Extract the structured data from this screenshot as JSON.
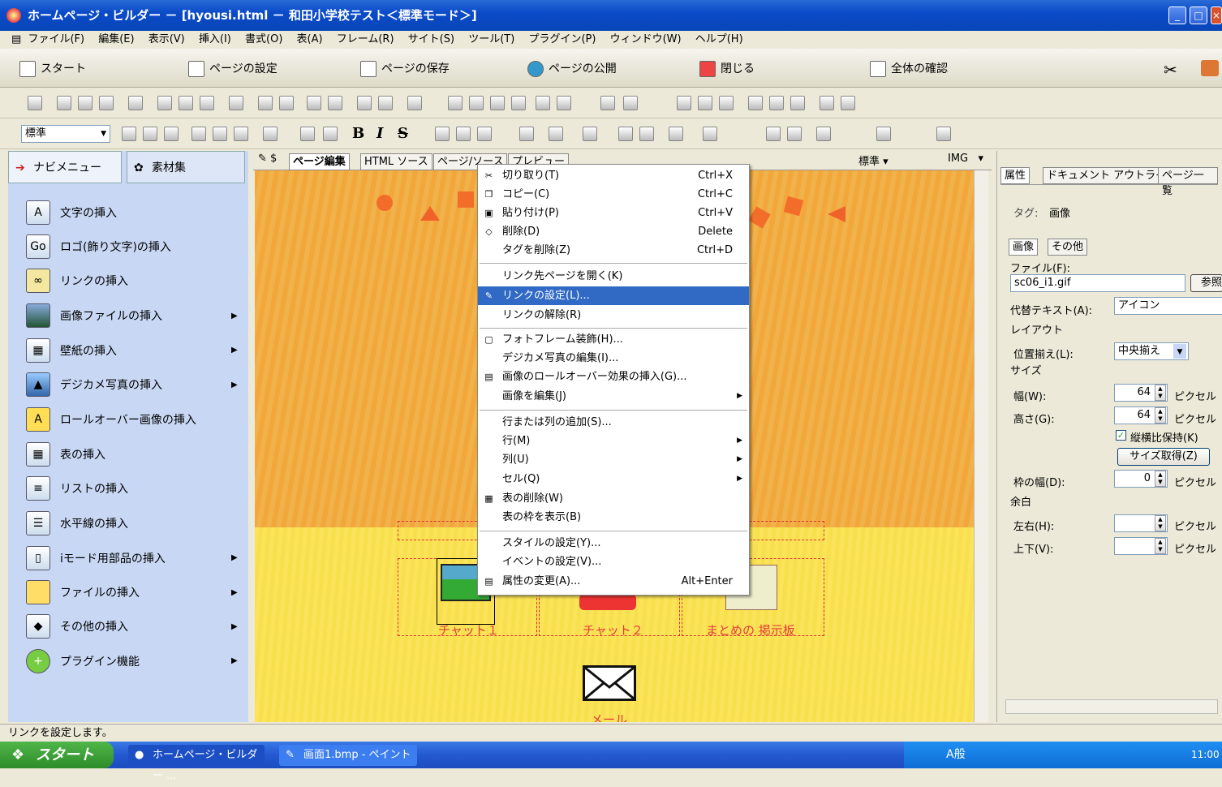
{
  "window": {
    "title": "ホームページ・ビルダー － [hyousi.html － 和田小学校テスト＜標準モード＞]"
  },
  "menubar": [
    "ファイル(F)",
    "編集(E)",
    "表示(V)",
    "挿入(I)",
    "書式(O)",
    "表(A)",
    "フレーム(R)",
    "サイト(S)",
    "ツール(T)",
    "プラグイン(P)",
    "ウィンドウ(W)",
    "ヘルプ(H)"
  ],
  "nav_toolbar": [
    "スタート",
    "ページの設定",
    "ページの保存",
    "ページの公開",
    "閉じる",
    "全体の確認"
  ],
  "format_toolbar": {
    "style_select": "標準",
    "bold": "B",
    "italic": "I",
    "strike": "S"
  },
  "left_panel": {
    "tabs": [
      "ナビメニュー",
      "素材集"
    ],
    "items": [
      "文字の挿入",
      "ロゴ(飾り文字)の挿入",
      "リンクの挿入",
      "画像ファイルの挿入",
      "壁紙の挿入",
      "デジカメ写真の挿入",
      "ロールオーバー画像の挿入",
      "表の挿入",
      "リストの挿入",
      "水平線の挿入",
      "iモード用部品の挿入",
      "ファイルの挿入",
      "その他の挿入",
      "プラグイン機能"
    ]
  },
  "editor": {
    "tabs": [
      "ページ編集",
      "HTML ソース",
      "ページ/ソース",
      "プレビュー"
    ],
    "style_dropdown": "標準",
    "element_dropdown": "IMG",
    "captions": [
      "チャット１",
      "チャット２",
      "まとめの 掲示板"
    ],
    "mail_caption": "メール"
  },
  "context_menu": {
    "items": [
      {
        "label": "切り取り(T)",
        "shortcut": "Ctrl+X"
      },
      {
        "label": "コピー(C)",
        "shortcut": "Ctrl+C"
      },
      {
        "label": "貼り付け(P)",
        "shortcut": "Ctrl+V"
      },
      {
        "label": "削除(D)",
        "shortcut": "Delete"
      },
      {
        "label": "タグを削除(Z)",
        "shortcut": "Ctrl+D"
      },
      {
        "label": "リンク先ページを開く(K)",
        "shortcut": ""
      },
      {
        "label": "リンクの設定(L)...",
        "shortcut": ""
      },
      {
        "label": "リンクの解除(R)",
        "shortcut": ""
      },
      {
        "label": "フォトフレーム装飾(H)...",
        "shortcut": ""
      },
      {
        "label": "デジカメ写真の編集(I)...",
        "shortcut": ""
      },
      {
        "label": "画像のロールオーバー効果の挿入(G)...",
        "shortcut": ""
      },
      {
        "label": "画像を編集(J)",
        "shortcut": ""
      },
      {
        "label": "行または列の追加(S)...",
        "shortcut": ""
      },
      {
        "label": "行(M)",
        "shortcut": ""
      },
      {
        "label": "列(U)",
        "shortcut": ""
      },
      {
        "label": "セル(Q)",
        "shortcut": ""
      },
      {
        "label": "表の削除(W)",
        "shortcut": ""
      },
      {
        "label": "表の枠を表示(B)",
        "shortcut": ""
      },
      {
        "label": "スタイルの設定(Y)...",
        "shortcut": ""
      },
      {
        "label": "イベントの設定(V)...",
        "shortcut": ""
      },
      {
        "label": "属性の変更(A)...",
        "shortcut": "Alt+Enter"
      }
    ]
  },
  "right_panel": {
    "tabs": [
      "属性",
      "ドキュメント アウトライナ",
      "ページ一覧"
    ],
    "tag_label": "タグ:",
    "tag_value": "画像",
    "subtabs": [
      "画像",
      "その他"
    ],
    "file_label": "ファイル(F):",
    "file_value": "sc06_i1.gif",
    "browse": "参照",
    "alt_label": "代替テキスト(A):",
    "alt_value": "アイコン",
    "layout": "レイアウト",
    "align_label": "位置揃え(L):",
    "align_value": "中央揃え",
    "size": "サイズ",
    "width_label": "幅(W):",
    "width_value": "64",
    "height_label": "高さ(G):",
    "height_value": "64",
    "unit": "ピクセル",
    "keep_ratio": "縦横比保持(K)",
    "get_size": "サイズ取得(Z)",
    "border_label": "枠の幅(D):",
    "border_value": "0",
    "margin": "余白",
    "lr_label": "左右(H):",
    "tb_label": "上下(V):"
  },
  "statusbar": "リンクを設定します。",
  "taskbar": {
    "start": "スタート",
    "tasks": [
      "ホームページ・ビルダー ...",
      "画面1.bmp - ペイント"
    ],
    "ime": "A般",
    "clock": "11:00"
  }
}
